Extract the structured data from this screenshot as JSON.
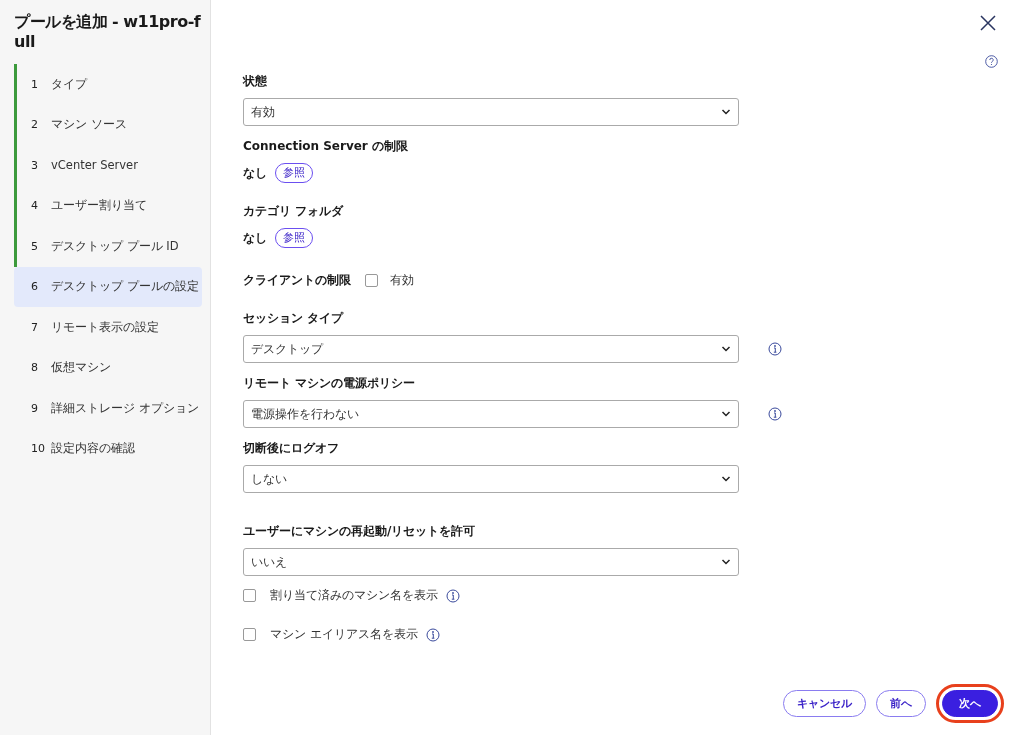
{
  "dialog": {
    "title": "プールを追加 - w11pro-full"
  },
  "steps": [
    {
      "number": "1",
      "label": "タイプ",
      "completed": true,
      "selected": false
    },
    {
      "number": "2",
      "label": "マシン ソース",
      "completed": true,
      "selected": false
    },
    {
      "number": "3",
      "label": "vCenter Server",
      "completed": true,
      "selected": false
    },
    {
      "number": "4",
      "label": "ユーザー割り当て",
      "completed": true,
      "selected": false
    },
    {
      "number": "5",
      "label": "デスクトップ プール ID",
      "completed": true,
      "selected": false
    },
    {
      "number": "6",
      "label": "デスクトップ プールの設定",
      "completed": false,
      "selected": true
    },
    {
      "number": "7",
      "label": "リモート表示の設定",
      "completed": false,
      "selected": false
    },
    {
      "number": "8",
      "label": "仮想マシン",
      "completed": false,
      "selected": false
    },
    {
      "number": "9",
      "label": "詳細ストレージ オプション",
      "completed": false,
      "selected": false
    },
    {
      "number": "10",
      "label": "設定内容の確認",
      "completed": false,
      "selected": false
    }
  ],
  "fields": [
    {
      "kind": "select",
      "label": "状態",
      "value": "有効",
      "info": false
    },
    {
      "kind": "reference",
      "label": "Connection Server の制限",
      "value": "なし",
      "button": "参照"
    },
    {
      "kind": "reference",
      "label": "カテゴリ フォルダ",
      "value": "なし",
      "button": "参照"
    },
    {
      "kind": "inline-checkbox",
      "label": "クライアントの制限",
      "option": "有効",
      "checked": false
    },
    {
      "kind": "select",
      "label": "セッション タイプ",
      "value": "デスクトップ",
      "info": true
    },
    {
      "kind": "select",
      "label": "リモート マシンの電源ポリシー",
      "value": "電源操作を行わない",
      "info": true
    },
    {
      "kind": "select",
      "label": "切断後にログオフ",
      "value": "しない",
      "info": false
    },
    {
      "kind": "select",
      "label": "ユーザーにマシンの再起動/リセットを許可",
      "value": "いいえ",
      "info": false
    },
    {
      "kind": "checkbox",
      "label": "割り当て済みのマシン名を表示",
      "checked": false,
      "info": true
    },
    {
      "kind": "checkbox",
      "label": "マシン エイリアス名を表示",
      "checked": false,
      "info": true
    }
  ],
  "buttons": [
    {
      "kind": "secondary",
      "label": "キャンセル",
      "highlighted": false
    },
    {
      "kind": "secondary",
      "label": "前へ",
      "highlighted": false
    },
    {
      "kind": "primary",
      "label": "次へ",
      "highlighted": true
    }
  ]
}
